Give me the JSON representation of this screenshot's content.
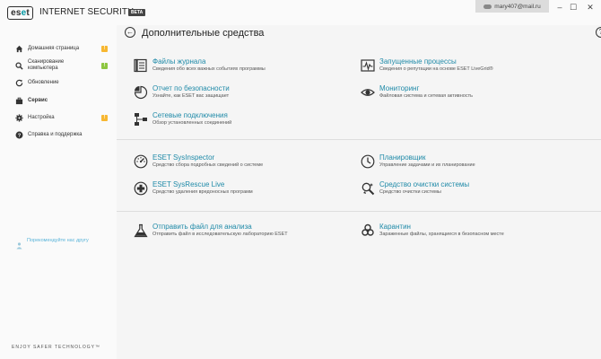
{
  "app": {
    "brand": "eset",
    "product": "INTERNET SECURITY",
    "badge": "BETA",
    "account": "mary407@mail.ru",
    "minimize_glyph": "–",
    "maximize_glyph": "☐",
    "close_glyph": "✕"
  },
  "sidebar": {
    "items": [
      {
        "label": "Домашняя страница",
        "icon": "home-icon",
        "badge": "!",
        "badge_color": "#f7b731"
      },
      {
        "label": "Сканирование компьютера",
        "icon": "search-icon",
        "badge": "!",
        "badge_color": "#8dc63f"
      },
      {
        "label": "Обновление",
        "icon": "refresh-icon"
      },
      {
        "label": "Сервис",
        "icon": "briefcase-icon"
      },
      {
        "label": "Настройка",
        "icon": "gear-icon",
        "badge": "!",
        "badge_color": "#f7b731"
      },
      {
        "label": "Справка и поддержка",
        "icon": "help-icon"
      }
    ],
    "recommend": "Порекомендуйте нас другу",
    "tagline": "ENJOY SAFER TECHNOLOGY™"
  },
  "main": {
    "title": "Дополнительные средства",
    "back_glyph": "←",
    "help_glyph": "?",
    "tools": [
      {
        "title": "Файлы журнала",
        "desc": "Сведения обо всех важных событиях программы",
        "icon": "log-files-icon"
      },
      {
        "title": "Запущенные процессы",
        "desc": "Сведения о репутации на основе ESET LiveGrid®",
        "icon": "running-processes-icon"
      },
      {
        "title": "Отчет по безопасности",
        "desc": "Узнайте, как ESET вас защищает",
        "icon": "security-report-icon"
      },
      {
        "title": "Мониторинг",
        "desc": "Файловая система и сетевая активность",
        "icon": "eye-icon"
      },
      {
        "title": "Сетевые подключения",
        "desc": "Обзор установленных соединений",
        "icon": "network-icon"
      },
      {
        "title": "ESET SysInspector",
        "desc": "Средство сбора подробных сведений о системе",
        "icon": "gauge-icon"
      },
      {
        "title": "Планировщик",
        "desc": "Управление задачами и их планирование",
        "icon": "clock-icon"
      },
      {
        "title": "ESET SysRescue Live",
        "desc": "Средство удаления вредоносных программ",
        "icon": "rescue-cross-icon"
      },
      {
        "title": "Средство очистки системы",
        "desc": "Средство очистки системы",
        "icon": "cleaner-icon"
      },
      {
        "title": "Отправить файл для анализа",
        "desc": "Отправить файл в исследовательскую лабораторию ESET",
        "icon": "flask-icon"
      },
      {
        "title": "Карантин",
        "desc": "Зараженные файлы, хранящиеся в безопасном месте",
        "icon": "biohazard-icon"
      }
    ]
  }
}
